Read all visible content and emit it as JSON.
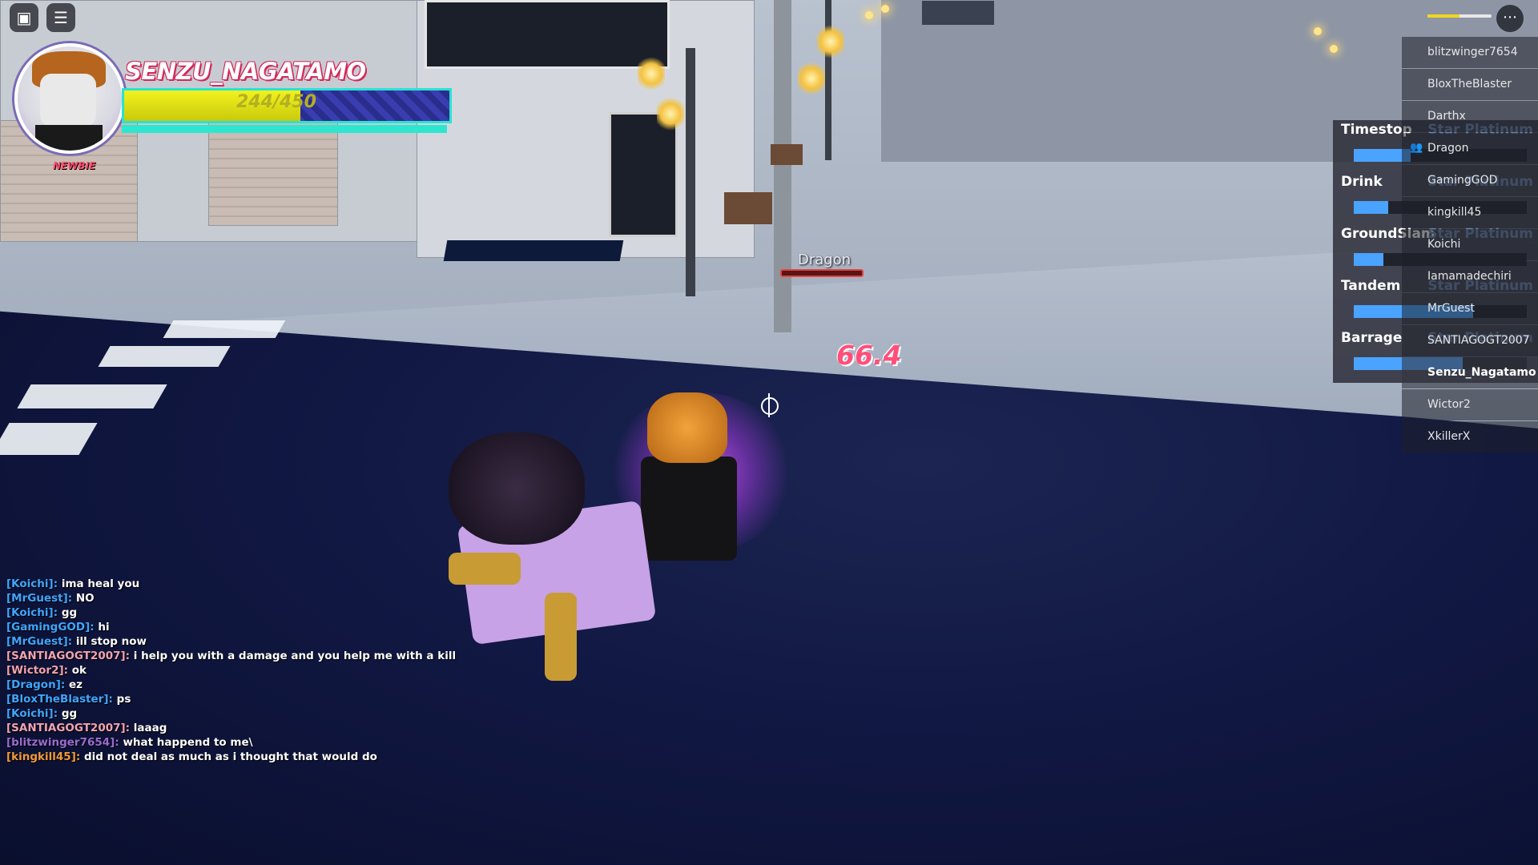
{
  "hud": {
    "player_name": "SENZU_NAGATAMO",
    "rank": "NEWBIE",
    "health_text": "244/450",
    "health_fraction": 0.542,
    "stamina_fraction": 1.0,
    "colors": {
      "name_outline": "#d4285a",
      "health_fill": "#f2f21f",
      "health_border": "#29e3d1",
      "damage": "#ff4f7a",
      "cooldown": "#4aa3ff"
    }
  },
  "world": {
    "enemy_name": "Dragon",
    "damage_number": "66.4"
  },
  "moves": [
    {
      "name": "Timestop",
      "stand": "Star Platinum",
      "cooldown_fraction": 0.33
    },
    {
      "name": "Drink",
      "stand": "Star Platinum",
      "cooldown_fraction": 0.2
    },
    {
      "name": "GroundSlam",
      "stand": "Star Platinum",
      "cooldown_fraction": 0.17
    },
    {
      "name": "Tandem",
      "stand": "Star Platinum",
      "cooldown_fraction": 0.69
    },
    {
      "name": "Barrage",
      "stand": "Star Platinum",
      "cooldown_fraction": 0.63
    }
  ],
  "playerlist": {
    "players": [
      {
        "name": "blitzwinger7654"
      },
      {
        "name": "BloxTheBlaster"
      },
      {
        "name": "Darthx"
      },
      {
        "name": "Dragon",
        "friend": true
      },
      {
        "name": "GamingGOD"
      },
      {
        "name": "kingkill45"
      },
      {
        "name": "Koichi"
      },
      {
        "name": "Iamamadechiri"
      },
      {
        "name": "MrGuest"
      },
      {
        "name": "SANTIAGOGT2007"
      },
      {
        "name": "Senzu_Nagatamo",
        "local": true
      },
      {
        "name": "Wictor2"
      },
      {
        "name": "XkillerX"
      }
    ]
  },
  "chat": [
    {
      "name": "[Koichi]:",
      "text": "ima heal you",
      "color": "#3ea6ff"
    },
    {
      "name": "[MrGuest]:",
      "text": "NO",
      "color": "#3ea6ff"
    },
    {
      "name": "[Koichi]:",
      "text": "gg",
      "color": "#3ea6ff"
    },
    {
      "name": "[GamingGOD]:",
      "text": "hi",
      "color": "#3ea6ff"
    },
    {
      "name": "[MrGuest]:",
      "text": "ill stop now",
      "color": "#3ea6ff"
    },
    {
      "name": "[SANTIAGOGT2007]:",
      "text": "i help you with a damage and you help me with a kill",
      "color": "#f2a3b0"
    },
    {
      "name": "[Wictor2]:",
      "text": "ok",
      "color": "#f2a3b0"
    },
    {
      "name": "[Dragon]:",
      "text": "ez",
      "color": "#3ea6ff"
    },
    {
      "name": "[BloxTheBlaster]:",
      "text": "ps",
      "color": "#3ea6ff"
    },
    {
      "name": "[Koichi]:",
      "text": "gg",
      "color": "#3ea6ff"
    },
    {
      "name": "[SANTIAGOGT2007]:",
      "text": "laaag",
      "color": "#f2a3b0"
    },
    {
      "name": "[blitzwinger7654]:",
      "text": "what happend to me\\",
      "color": "#9b6bcf"
    },
    {
      "name": "[kingkill45]:",
      "text": "did not deal as much as i thought that would do",
      "color": "#f29a3a"
    }
  ],
  "icons": {
    "roblox": "roblox-logo-icon",
    "chat": "chat-icon",
    "menu": "more-options-icon",
    "friend": "friend-icon"
  }
}
